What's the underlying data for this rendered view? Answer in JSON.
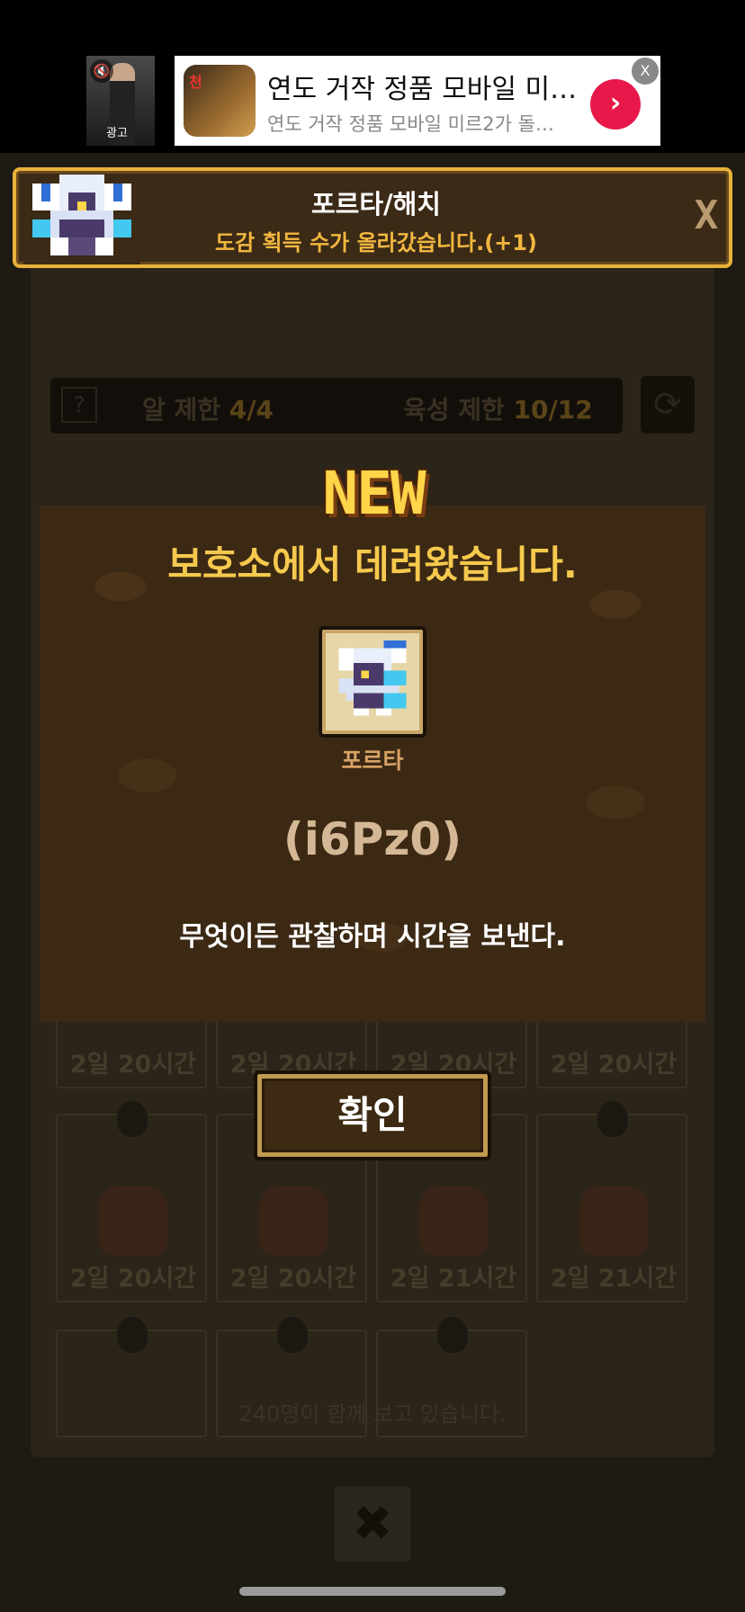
{
  "ad": {
    "label": "광고",
    "title": "연도 거작 정품 모바일 미…",
    "subtitle": "연도 거작 정품 모바일 미르2가 돌…",
    "logo_text": "천",
    "close": "X",
    "cta_icon": "chevron-right-icon"
  },
  "notification": {
    "title": "포르타/해치",
    "subtitle": "도감 획득 수가 올라갔습니다.(+1)",
    "close": "X"
  },
  "background": {
    "egg_limit_label": "알 제한",
    "egg_limit_value": "4/4",
    "raise_limit_label": "육성 제한",
    "raise_limit_value": "10/12",
    "help": "?",
    "slots_row1": [
      "2일 20시간",
      "2일 20시간",
      "2일 20시간",
      "2일 20시간"
    ],
    "slots_row2": [
      "2일 20시간",
      "2일 20시간",
      "2일 21시간",
      "2일 21시간"
    ],
    "viewers": "240명이 함께 보고 있습니다.",
    "close": "✖"
  },
  "modal": {
    "badge": "NEW",
    "title": "보호소에서 데려왔습니다.",
    "pet_name": "포르타",
    "pet_code": "(i6Pz0)",
    "description": "무엇이든 관찰하며 시간을 보낸다.",
    "confirm": "확인"
  },
  "colors": {
    "accent_gold": "#f6c94e",
    "notif_border": "#e8b23a",
    "ad_cta": "#e8194a"
  }
}
